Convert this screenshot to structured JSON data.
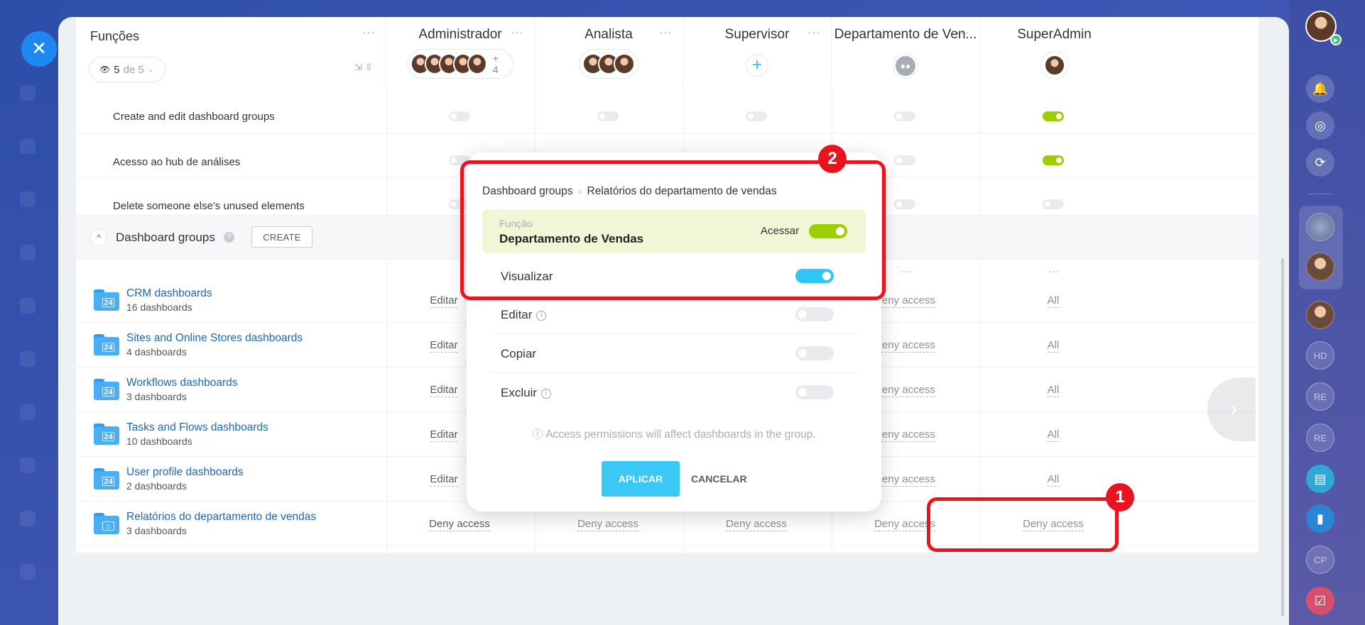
{
  "close_icon": "✕",
  "header": {
    "functions_title": "Funções",
    "filter": {
      "count": "5",
      "of_label": "de 5"
    },
    "roles": [
      {
        "name": "Administrador",
        "more": "+ 4"
      },
      {
        "name": "Analista"
      },
      {
        "name": "Supervisor"
      },
      {
        "name": "Departamento de Ven..."
      },
      {
        "name": "SuperAdmin"
      }
    ]
  },
  "permissions": [
    {
      "label": "Create and edit dashboard groups",
      "values": [
        false,
        false,
        false,
        false,
        true
      ]
    },
    {
      "label": "Acesso ao hub de análises",
      "values": [
        false,
        true,
        false,
        false,
        true
      ]
    },
    {
      "label": "Delete someone else's unused elements",
      "values": [
        false,
        false,
        false,
        false,
        false
      ]
    }
  ],
  "section": {
    "title": "Dashboard groups",
    "help": "?",
    "create_label": "CREATE"
  },
  "groups": [
    {
      "name": "CRM dashboards",
      "count": "16 dashboards",
      "cells": [
        "Editar",
        "",
        "",
        "Deny access",
        "All"
      ]
    },
    {
      "name": "Sites and Online Stores dashboards",
      "count": "4 dashboards",
      "cells": [
        "Editar",
        "",
        "",
        "Deny access",
        "All"
      ]
    },
    {
      "name": "Workflows dashboards",
      "count": "3 dashboards",
      "cells": [
        "Editar",
        "",
        "",
        "Deny access",
        "All"
      ]
    },
    {
      "name": "Tasks and Flows dashboards",
      "count": "10 dashboards",
      "cells": [
        "Editar",
        "",
        "",
        "Deny access",
        "All"
      ]
    },
    {
      "name": "User profile dashboards",
      "count": "2 dashboards",
      "cells": [
        "Editar",
        "",
        "",
        "Deny access",
        "All"
      ]
    },
    {
      "name": "Relatórios do departamento de vendas",
      "count": "3 dashboards",
      "cells": [
        "Deny access",
        "Deny access",
        "Deny access",
        "Deny access",
        "Deny access"
      ]
    }
  ],
  "popup": {
    "breadcrumb_root": "Dashboard groups",
    "breadcrumb_leaf": "Relatórios do departamento de vendas",
    "role_label": "Função",
    "role_name": "Departamento de Vendas",
    "access_label": "Acessar",
    "access_on": true,
    "options": [
      {
        "label": "Visualizar",
        "info": false,
        "on": true
      },
      {
        "label": "Editar",
        "info": true,
        "on": false
      },
      {
        "label": "Copiar",
        "info": false,
        "on": false
      },
      {
        "label": "Excluir",
        "info": true,
        "on": false
      }
    ],
    "note": "ⓘ Access permissions will affect dashboards in the group.",
    "apply_label": "APLICAR",
    "cancel_label": "CANCELAR"
  },
  "callouts": [
    "1",
    "2"
  ],
  "right_bar": {
    "initials": [
      "HD",
      "RE",
      "RE",
      "CP"
    ]
  },
  "colors": {
    "accent_blue": "#2fc6f6",
    "toggle_on": "#9dcf00",
    "callout_red": "#e8141f",
    "link": "#2067b0"
  }
}
